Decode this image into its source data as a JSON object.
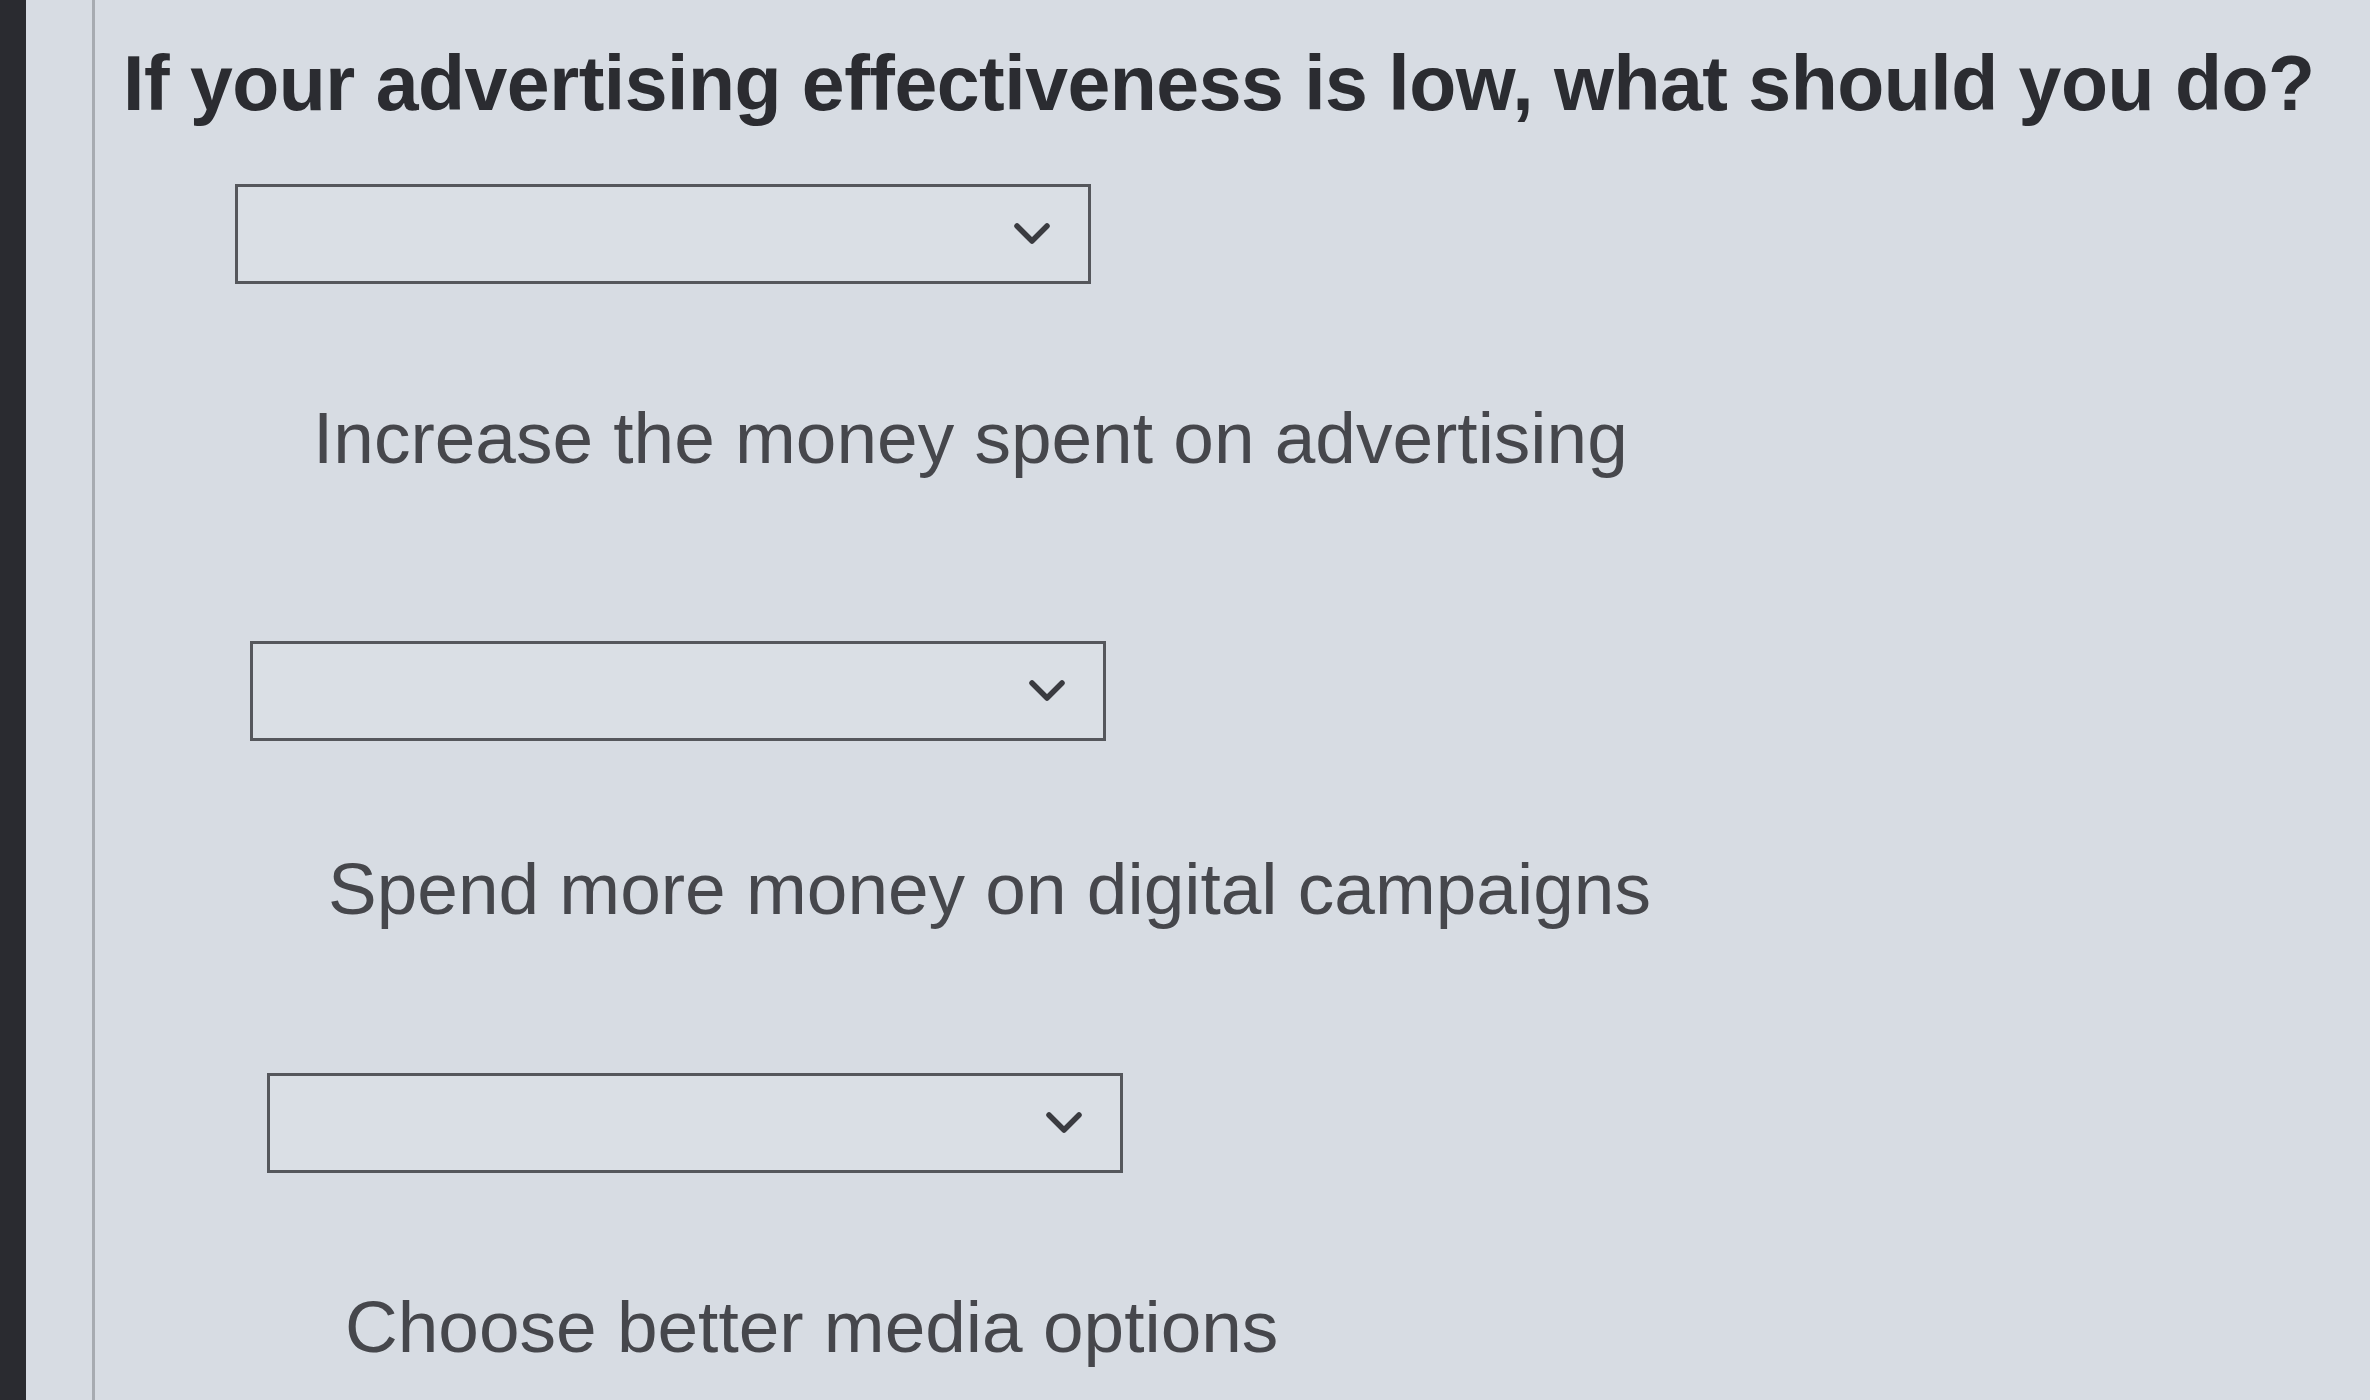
{
  "question": "If your advertising effectiveness is low, what should you do?",
  "items": [
    {
      "statement": "Increase the money spent on advertising"
    },
    {
      "statement": "Spend more money on digital campaigns"
    },
    {
      "statement": "Choose better media options"
    }
  ]
}
